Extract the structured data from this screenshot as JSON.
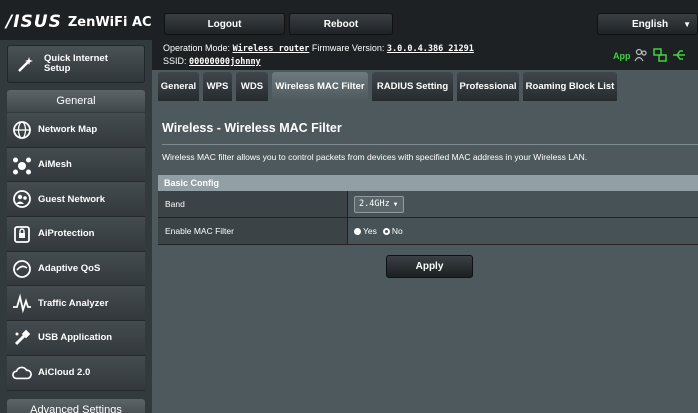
{
  "header": {
    "brand": "/ISUS",
    "model": "ZenWiFi AC",
    "logout_label": "Logout",
    "reboot_label": "Reboot",
    "language": "English"
  },
  "sidebar": {
    "quick_setup": "Quick Internet Setup",
    "general_label": "General",
    "items": [
      {
        "label": "Network Map",
        "icon": "globe-icon"
      },
      {
        "label": "AiMesh",
        "icon": "mesh-icon"
      },
      {
        "label": "Guest Network",
        "icon": "users-icon"
      },
      {
        "label": "AiProtection",
        "icon": "lock-icon"
      },
      {
        "label": "Adaptive QoS",
        "icon": "gauge-icon"
      },
      {
        "label": "Traffic Analyzer",
        "icon": "pulse-icon"
      },
      {
        "label": "USB Application",
        "icon": "usb-icon"
      },
      {
        "label": "AiCloud 2.0",
        "icon": "cloud-icon"
      }
    ],
    "advanced_label": "Advanced Settings"
  },
  "status": {
    "mode_label": "Operation Mode:",
    "mode_value": "Wireless router",
    "fw_label": "Firmware Version:",
    "fw_value": "3.0.0.4.386_21291",
    "ssid_label": "SSID:",
    "ssid_value": "00000000johnny",
    "app_label": "App"
  },
  "tabs": [
    {
      "label": "General"
    },
    {
      "label": "WPS"
    },
    {
      "label": "WDS"
    },
    {
      "label": "Wireless MAC Filter"
    },
    {
      "label": "RADIUS Setting"
    },
    {
      "label": "Professional"
    },
    {
      "label": "Roaming Block List"
    }
  ],
  "page": {
    "title": "Wireless - Wireless MAC Filter",
    "description": "Wireless MAC filter allows you to control packets from devices with specified MAC address in your Wireless LAN.",
    "section": "Basic Config",
    "band_label": "Band",
    "band_value": "2.4GHz",
    "enable_label": "Enable MAC Filter",
    "yes_label": "Yes",
    "no_label": "No",
    "apply_label": "Apply"
  },
  "colors": {
    "app_green": "#40d040",
    "accent": "#92a0a5"
  }
}
